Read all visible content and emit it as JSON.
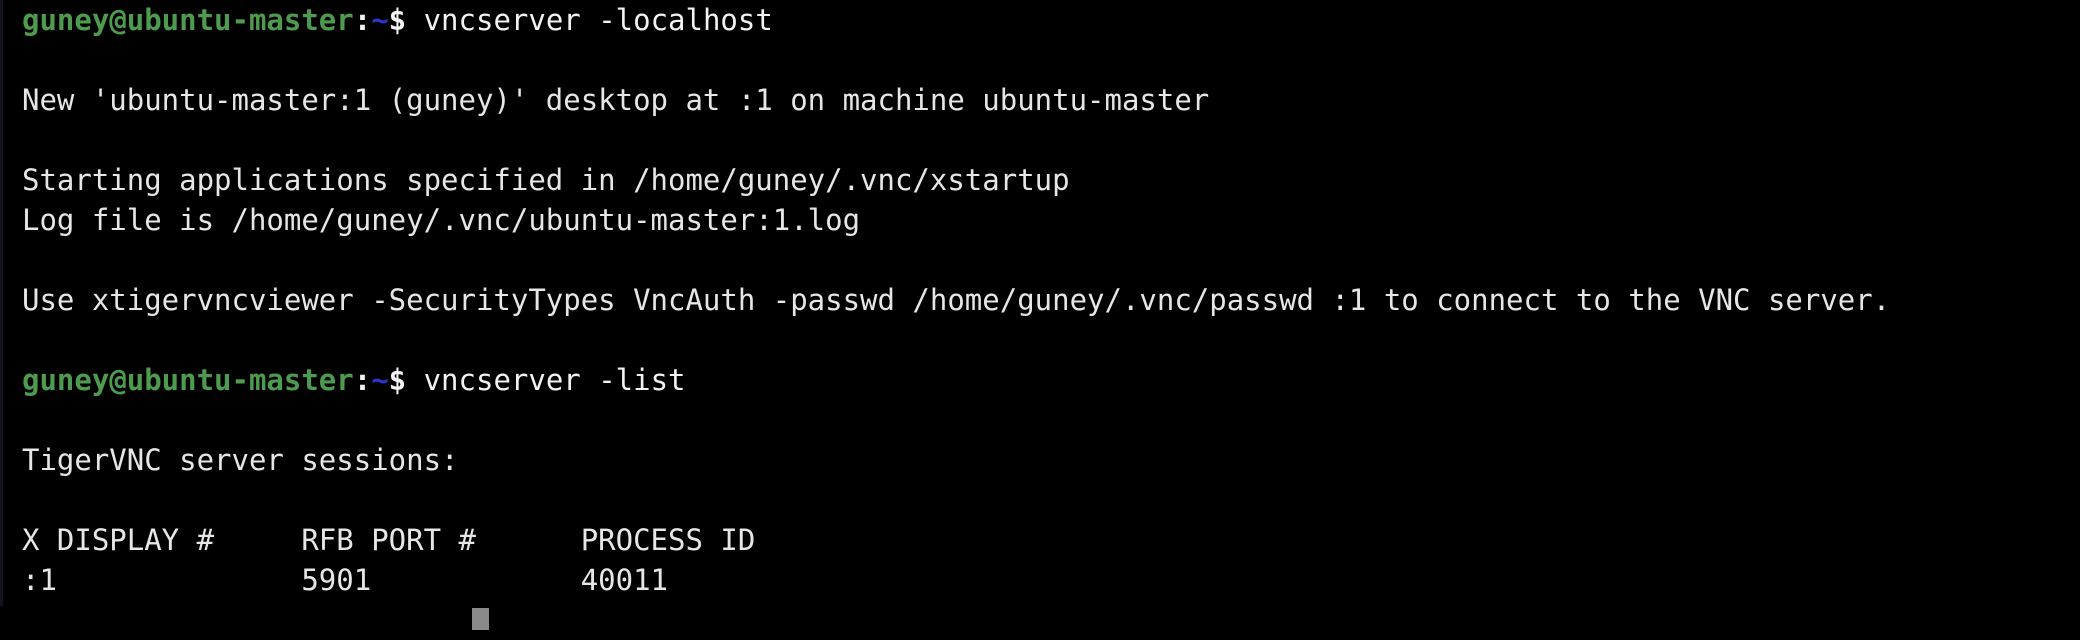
{
  "terminal": {
    "background_color": "#000000",
    "foreground_color": "#e8e8e8",
    "prompt_user_color": "#4e9a4e",
    "prompt_path_color": "#2b35cf",
    "cursor_color": "#8a8a8a",
    "prompt": {
      "user_host": "guney@ubuntu-master",
      "colon": ":",
      "path": "~",
      "dollar": "$"
    },
    "lines": [
      {
        "type": "prompt",
        "command": "vncserver -localhost"
      },
      {
        "type": "blank",
        "text": ""
      },
      {
        "type": "output",
        "text": "New 'ubuntu-master:1 (guney)' desktop at :1 on machine ubuntu-master"
      },
      {
        "type": "blank",
        "text": ""
      },
      {
        "type": "output",
        "text": "Starting applications specified in /home/guney/.vnc/xstartup"
      },
      {
        "type": "output",
        "text": "Log file is /home/guney/.vnc/ubuntu-master:1.log"
      },
      {
        "type": "blank",
        "text": ""
      },
      {
        "type": "output",
        "text": "Use xtigervncviewer -SecurityTypes VncAuth -passwd /home/guney/.vnc/passwd :1 to connect to the VNC server."
      },
      {
        "type": "blank",
        "text": ""
      },
      {
        "type": "prompt",
        "command": "vncserver -list"
      },
      {
        "type": "blank",
        "text": ""
      },
      {
        "type": "output",
        "text": "TigerVNC server sessions:"
      },
      {
        "type": "blank",
        "text": ""
      },
      {
        "type": "output",
        "text": "X DISPLAY #     RFB PORT #      PROCESS ID"
      },
      {
        "type": "output",
        "text": ":1              5901            40011"
      }
    ],
    "session_table": {
      "headers": [
        "X DISPLAY #",
        "RFB PORT #",
        "PROCESS ID"
      ],
      "rows": [
        [
          "1",
          "5901",
          "40011"
        ]
      ]
    },
    "cursor": {
      "glyph": "",
      "visible": true
    }
  }
}
